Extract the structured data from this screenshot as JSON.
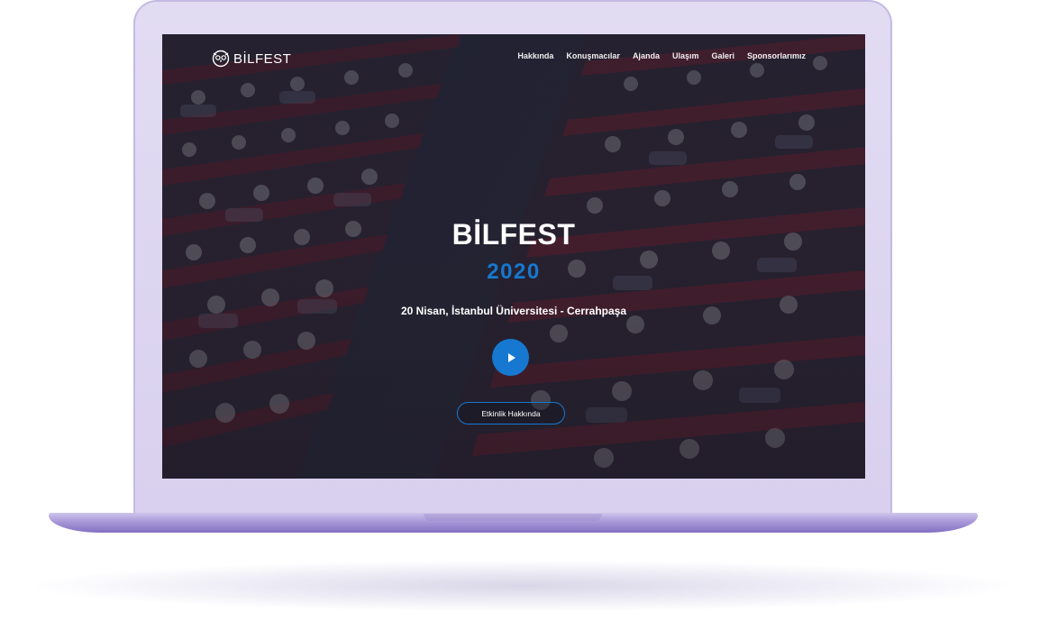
{
  "brand": {
    "logo_icon": "owl-emblem-icon",
    "name": "BİLFEST"
  },
  "nav": {
    "items": [
      {
        "label": "Hakkında"
      },
      {
        "label": "Konuşmacılar"
      },
      {
        "label": "Ajanda"
      },
      {
        "label": "Ulaşım"
      },
      {
        "label": "Galeri"
      },
      {
        "label": "Sponsorlarımız"
      }
    ]
  },
  "hero": {
    "title": "BİLFEST",
    "year": "2020",
    "subtitle": "20 Nisan, İstanbul Üniversitesi - Cerrahpaşa",
    "play_icon": "play-icon",
    "cta_label": "Etkinlik Hakkında",
    "background_icon": "conference-audience-photo"
  },
  "colors": {
    "accent": "#1678d0",
    "laptop_body": "#d8d0ee",
    "screen_overlay": "#161a2a"
  }
}
